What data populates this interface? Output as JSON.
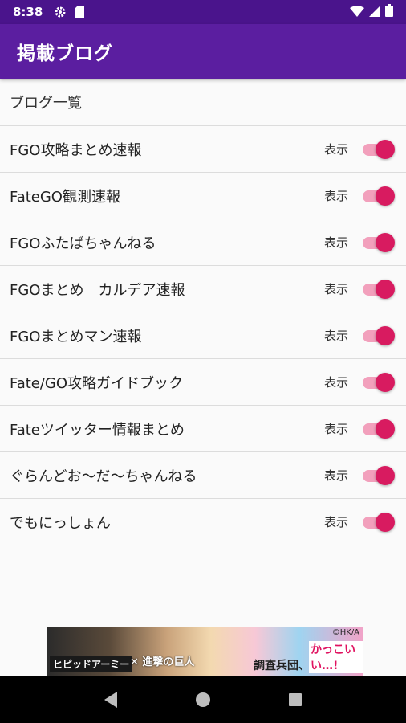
{
  "status_bar": {
    "time": "8:38",
    "icons": [
      "gear-icon",
      "sd-card-icon",
      "wifi-icon",
      "signal-icon",
      "battery-icon"
    ]
  },
  "app_bar": {
    "title": "掲載ブログ"
  },
  "list": {
    "header": "ブログ一覧",
    "toggle_label": "表示",
    "items": [
      {
        "name": "FGO攻略まとめ速報",
        "enabled": true
      },
      {
        "name": "FateGO観測速報",
        "enabled": true
      },
      {
        "name": "FGOふたばちゃんねる",
        "enabled": true
      },
      {
        "name": "FGOまとめ　カルデア速報",
        "enabled": true
      },
      {
        "name": "FGOまとめマン速報",
        "enabled": true
      },
      {
        "name": "Fate/GO攻略ガイドブック",
        "enabled": true
      },
      {
        "name": "Fateツイッター情報まとめ",
        "enabled": true
      },
      {
        "name": "ぐらんどお〜だ〜ちゃんねる",
        "enabled": true
      },
      {
        "name": "でもにっしょん",
        "enabled": true
      }
    ]
  },
  "banner": {
    "text1": "ヒピッドアーミー",
    "text2": "✕ 進撃の巨人",
    "text3": "調査兵団、",
    "text4": "かっこいい…!",
    "copyright": "©HK/A"
  },
  "colors": {
    "status_bar": "#4a148c",
    "app_bar": "#5b1ea0",
    "toggle_thumb": "#d81b60",
    "toggle_track": "#f2a0bc"
  },
  "nav_bar": {
    "icons": [
      "back-icon",
      "home-icon",
      "recents-icon"
    ]
  }
}
